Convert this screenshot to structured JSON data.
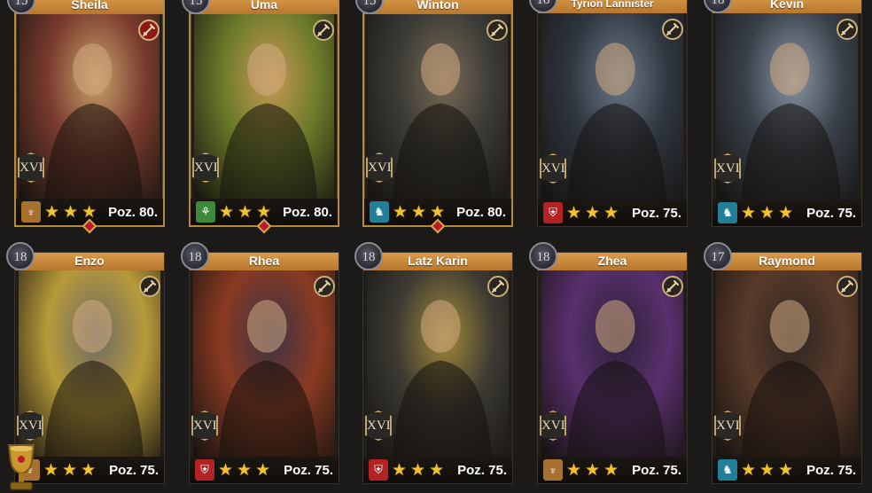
{
  "heroes": [
    {
      "name": "Sheila",
      "level": "15",
      "rank": "XVI",
      "badge": "bronze",
      "badge_icon": "♆",
      "sword": "red",
      "power": "Poz. 80.",
      "frame": "gold",
      "colors": [
        "#7a3b2e",
        "#c8a36a"
      ],
      "small": false
    },
    {
      "name": "Uma",
      "level": "15",
      "rank": "XVI",
      "badge": "green",
      "badge_icon": "⚘",
      "sword": "dark",
      "power": "Poz. 80.",
      "frame": "gold",
      "colors": [
        "#6b7a2a",
        "#c99a55"
      ],
      "small": false
    },
    {
      "name": "Winton",
      "level": "15",
      "rank": "XVI",
      "badge": "teal",
      "badge_icon": "♞",
      "sword": "dark",
      "power": "Poz. 80.",
      "frame": "gold",
      "colors": [
        "#3a3a36",
        "#7a6a55"
      ],
      "small": false
    },
    {
      "name": "Tyrion Lannister",
      "level": "18",
      "rank": "XVI",
      "badge": "red",
      "badge_icon": "⛨",
      "sword": "dark",
      "power": "Poz. 75.",
      "frame": "plain",
      "colors": [
        "#2f3640",
        "#6d7a88"
      ],
      "small": true
    },
    {
      "name": "Kevin",
      "level": "18",
      "rank": "XVI",
      "badge": "teal",
      "badge_icon": "♞",
      "sword": "dark",
      "power": "Poz. 75.",
      "frame": "plain",
      "colors": [
        "#39404a",
        "#8a96a3"
      ],
      "small": false
    },
    {
      "name": "Enzo",
      "level": "18",
      "rank": "XVI",
      "badge": "bronze",
      "badge_icon": "♆",
      "sword": "dark",
      "power": "Poz. 75.",
      "frame": "plain",
      "colors": [
        "#b79a3a",
        "#6c6a64"
      ],
      "small": false
    },
    {
      "name": "Rhea",
      "level": "18",
      "rank": "XVI",
      "badge": "red",
      "badge_icon": "⛨",
      "sword": "dark",
      "power": "Poz. 75.",
      "frame": "plain",
      "colors": [
        "#8a3a22",
        "#3a3346"
      ],
      "small": false
    },
    {
      "name": "Latz Karin",
      "level": "18",
      "rank": "XVI",
      "badge": "red",
      "badge_icon": "⛨",
      "sword": "dark",
      "power": "Poz. 75.",
      "frame": "plain",
      "colors": [
        "#3c3a33",
        "#a38a3a"
      ],
      "small": false
    },
    {
      "name": "Zhea",
      "level": "18",
      "rank": "XVI",
      "badge": "bronze",
      "badge_icon": "♆",
      "sword": "dark",
      "power": "Poz. 75.",
      "frame": "plain",
      "colors": [
        "#5a2f6e",
        "#2a2235"
      ],
      "small": false
    },
    {
      "name": "Raymond",
      "level": "17",
      "rank": "XVI",
      "badge": "teal",
      "badge_icon": "♞",
      "sword": "dark",
      "power": "Poz. 75.",
      "frame": "plain",
      "colors": [
        "#5a3a2a",
        "#2b2622"
      ],
      "small": false
    }
  ],
  "stars_per_card": 3,
  "accent_gold": "#d89a4a",
  "star_color": "#f1c232"
}
